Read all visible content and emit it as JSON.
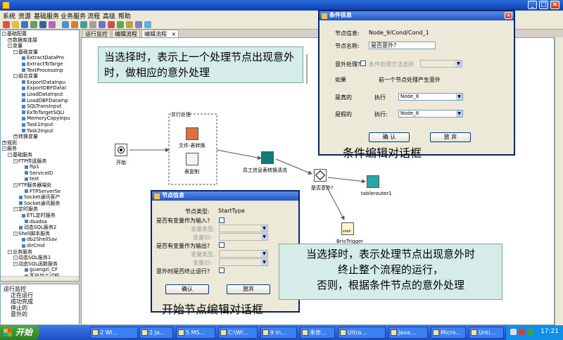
{
  "window": {
    "title": "",
    "minimize": "_",
    "maximize": "□",
    "close": "×"
  },
  "menu": [
    "系统",
    "资源",
    "基础服务",
    "业务服务",
    "流程",
    "高级",
    "帮助"
  ],
  "tree": {
    "rows": [
      {
        "pm": "-",
        "label": "基础配置"
      },
      {
        "pm": "+",
        "label": "数据库连接"
      },
      {
        "pm": "-",
        "label": "变量"
      },
      {
        "pm": "-",
        "label": "基础变量"
      },
      {
        "leaf": true,
        "label": "ExtractDataPro"
      },
      {
        "leaf": true,
        "label": "ExtractToTarge"
      },
      {
        "leaf": true,
        "label": "TextProcessInp"
      },
      {
        "pm": "-",
        "label": "组合变量"
      },
      {
        "leaf": true,
        "label": "ExportDataInpu"
      },
      {
        "leaf": true,
        "label": "ExportDBFDataI"
      },
      {
        "leaf": true,
        "label": "LoadDataInput"
      },
      {
        "leaf": true,
        "label": "LoadDBFDataInp"
      },
      {
        "leaf": true,
        "label": "SQLTransInput"
      },
      {
        "leaf": true,
        "label": "ExToTargetSQLI"
      },
      {
        "leaf": true,
        "label": "MemoryCopyInpu"
      },
      {
        "leaf": true,
        "label": "Task1Input"
      },
      {
        "leaf": true,
        "label": "Task2Input"
      },
      {
        "pm": "+",
        "label": "转换变量"
      },
      {
        "pm": "+",
        "label": "规则"
      },
      {
        "pm": "-",
        "label": "服务"
      },
      {
        "pm": "-",
        "label": "基础服务"
      },
      {
        "pm": "-",
        "label": "FTP传送服务"
      },
      {
        "leaf": true,
        "label": "ftp1"
      },
      {
        "leaf": true,
        "label": "ServiceID"
      },
      {
        "leaf": true,
        "label": "test"
      },
      {
        "pm": "-",
        "label": "FTP服务器端处"
      },
      {
        "leaf": true,
        "label": "FTPServerSe"
      },
      {
        "leaf": true,
        "label": "Socket通讯客户"
      },
      {
        "leaf": true,
        "label": "Socket通讯服务"
      },
      {
        "pm": "-",
        "label": "定时服务"
      },
      {
        "leaf": true,
        "label": "ETL定时服务"
      },
      {
        "leaf": true,
        "label": "dsadsa"
      },
      {
        "leaf": true,
        "label": "动态SQL服务2"
      },
      {
        "pm": "-",
        "label": "Shell脚本服务"
      },
      {
        "leaf": true,
        "label": "db2ShellSav"
      },
      {
        "leaf": true,
        "label": "dirCmd"
      },
      {
        "pm": "-",
        "label": "业务服务"
      },
      {
        "pm": "-",
        "label": "动态SQL服务1"
      },
      {
        "pm": "-",
        "label": "动态SQL函数服务"
      },
      {
        "leaf": true,
        "label": "guangzi_CF"
      },
      {
        "leaf": true,
        "label": "客户加工过程"
      }
    ]
  },
  "monitor": {
    "header": "运行监控",
    "items": [
      "正在运行",
      "成功完成",
      "停止的",
      "意外的"
    ]
  },
  "tabs": [
    {
      "label": "运行监控"
    },
    {
      "label": "编辑流程"
    },
    {
      "label": "编辑流程",
      "active": true
    }
  ],
  "tab_close": "×",
  "nodes": {
    "start": "开始",
    "parallel": "并行处理",
    "file_convert": "文件-表转换",
    "table_copy": "表复制",
    "emp_convert": "员工信息表转换清洗",
    "condition": "是否意外?",
    "router": "tablerouter1",
    "shell": "BrioTrigger",
    "shell_badge": "shell"
  },
  "condition_dialog": {
    "title": "条件信息",
    "node_info_label": "节点信息:",
    "node_info_value": "Node_9/Cond/Cond_1",
    "node_name_label": "节点名称:",
    "node_name_value": "是否意外?",
    "exception_label": "意外处理?",
    "exception_select": "条件处理方法选择",
    "if_label": "如果",
    "if_value": "前一个节点处理产生意外",
    "true_label": "是真的",
    "true_exec": "执行",
    "true_value": "Node_8",
    "false_label": "是假的",
    "false_exec": "执行:",
    "false_value": "Node_6",
    "ok": "确 认",
    "cancel": "放 弃"
  },
  "node_dialog": {
    "title": "节点信息",
    "type_label": "节点类型:",
    "type_value": "StartType",
    "input_label": "是否有变量作为输入?",
    "in_var_type": "变量类型:",
    "in_var_id": "变量ID:",
    "output_label": "是否有变量作为输出?",
    "out_var_type": "变量类型:",
    "out_var_id": "变量ID:",
    "terminate_label": "意外时是否终止运行?",
    "ok": "确认",
    "cancel": "放弃"
  },
  "callouts": {
    "top": "当选择时，表示上一个处理节点出现意外时，做相应的意外处理",
    "bottom_l1": "当选择时，表示处理节点出现意外时",
    "bottom_l2": "终止整个流程的运行，",
    "bottom_l3": "否则，根据条件节点的意外处理"
  },
  "captions": {
    "condition": "条件编辑对话框",
    "start": "开始节点编辑对话框"
  },
  "taskbar": {
    "start": "开始",
    "buttons": [
      "2 Wi...",
      "2 Ja...",
      "5 MS...",
      "C:\\WI...",
      "9 In...",
      "未命...",
      "Ultra...",
      "Java...",
      "Micro...",
      "Unti..."
    ],
    "clock": "17:21"
  },
  "colors": {
    "accent": "#0a3fb2",
    "callout_bg": "#d6ece9",
    "desktop_gray": "#d4d0c8"
  }
}
